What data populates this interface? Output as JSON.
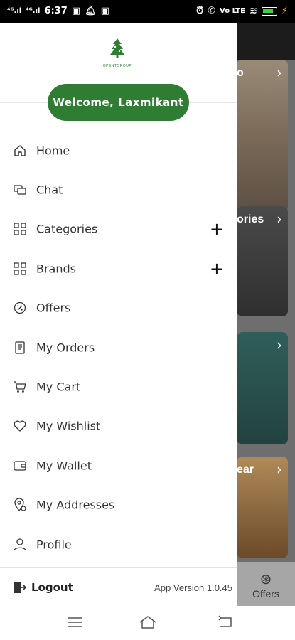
{
  "status_bar": {
    "network_left": "⁴ᴳ.ıl",
    "network_left2": "⁴ᴳ.ıl",
    "time": "6:37",
    "right_text": "Vo LTE"
  },
  "drawer": {
    "logo_text": "OPENTOROUP",
    "welcome": "Welcome, Laxmikant",
    "menu": [
      {
        "label": "Home",
        "icon": "home-icon"
      },
      {
        "label": "Chat",
        "icon": "chat-icon"
      },
      {
        "label": "Categories",
        "icon": "grid-icon",
        "expand": "+"
      },
      {
        "label": "Brands",
        "icon": "grid-icon",
        "expand": "+"
      },
      {
        "label": "Offers",
        "icon": "percent-badge-icon"
      },
      {
        "label": "My Orders",
        "icon": "orders-icon"
      },
      {
        "label": "My Cart",
        "icon": "cart-icon"
      },
      {
        "label": "My Wishlist",
        "icon": "heart-icon"
      },
      {
        "label": "My Wallet",
        "icon": "wallet-icon"
      },
      {
        "label": "My Addresses",
        "icon": "location-icon"
      },
      {
        "label": "Profile",
        "icon": "user-icon"
      }
    ],
    "logout": "Logout",
    "app_version": "App Version 1.0.45"
  },
  "background": {
    "card_labels": [
      "o",
      "ories",
      "",
      "ear"
    ],
    "offers_tab": "Offers"
  },
  "colors": {
    "brand_green": "#2e7d32",
    "overlay": "#6e6e6e"
  }
}
